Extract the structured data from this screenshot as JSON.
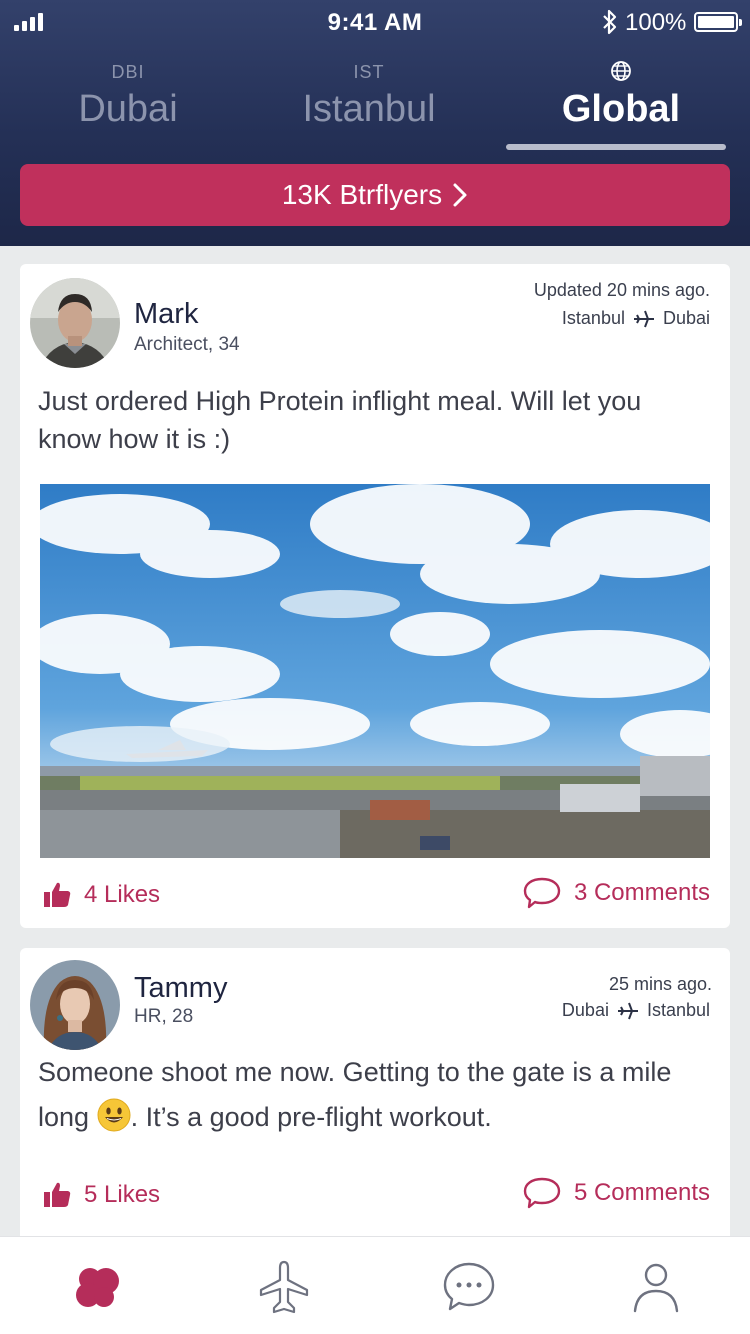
{
  "status_bar": {
    "time": "9:41 AM",
    "battery": "100%"
  },
  "city_tabs": [
    {
      "code": "DBI",
      "name": "Dubai"
    },
    {
      "code": "IST",
      "name": "Istanbul"
    },
    {
      "icon": "globe-icon",
      "name": "Global",
      "active": true
    }
  ],
  "flyers_button": {
    "label": "13K Btrflyers"
  },
  "posts": [
    {
      "user_name": "Mark",
      "user_sub": "Architect, 34",
      "updated": "Updated 20 mins ago.",
      "route_from": "Istanbul",
      "route_to": "Dubai",
      "text": "Just ordered High Protein inflight meal. Will let you know how it is :)",
      "likes": "4 Likes",
      "comments": "3 Comments"
    },
    {
      "user_name": "Tammy",
      "user_sub": "HR, 28",
      "updated": "25 mins ago.",
      "route_from": "Dubai",
      "route_to": "Istanbul",
      "text_before_emoji": "Someone shoot me now. Getting to the gate is a mile long ",
      "text_after_emoji": ". It’s a good pre-flight workout.",
      "likes": "5 Likes",
      "comments": "5 Comments"
    }
  ],
  "tab_bar": [
    {
      "icon": "butterfly-home-icon",
      "active": true
    },
    {
      "icon": "airplane-icon"
    },
    {
      "icon": "chat-icon"
    },
    {
      "icon": "profile-icon"
    }
  ],
  "colors": {
    "accent": "#c0305c",
    "header": "#243056",
    "like_text": "#b52d5a"
  }
}
